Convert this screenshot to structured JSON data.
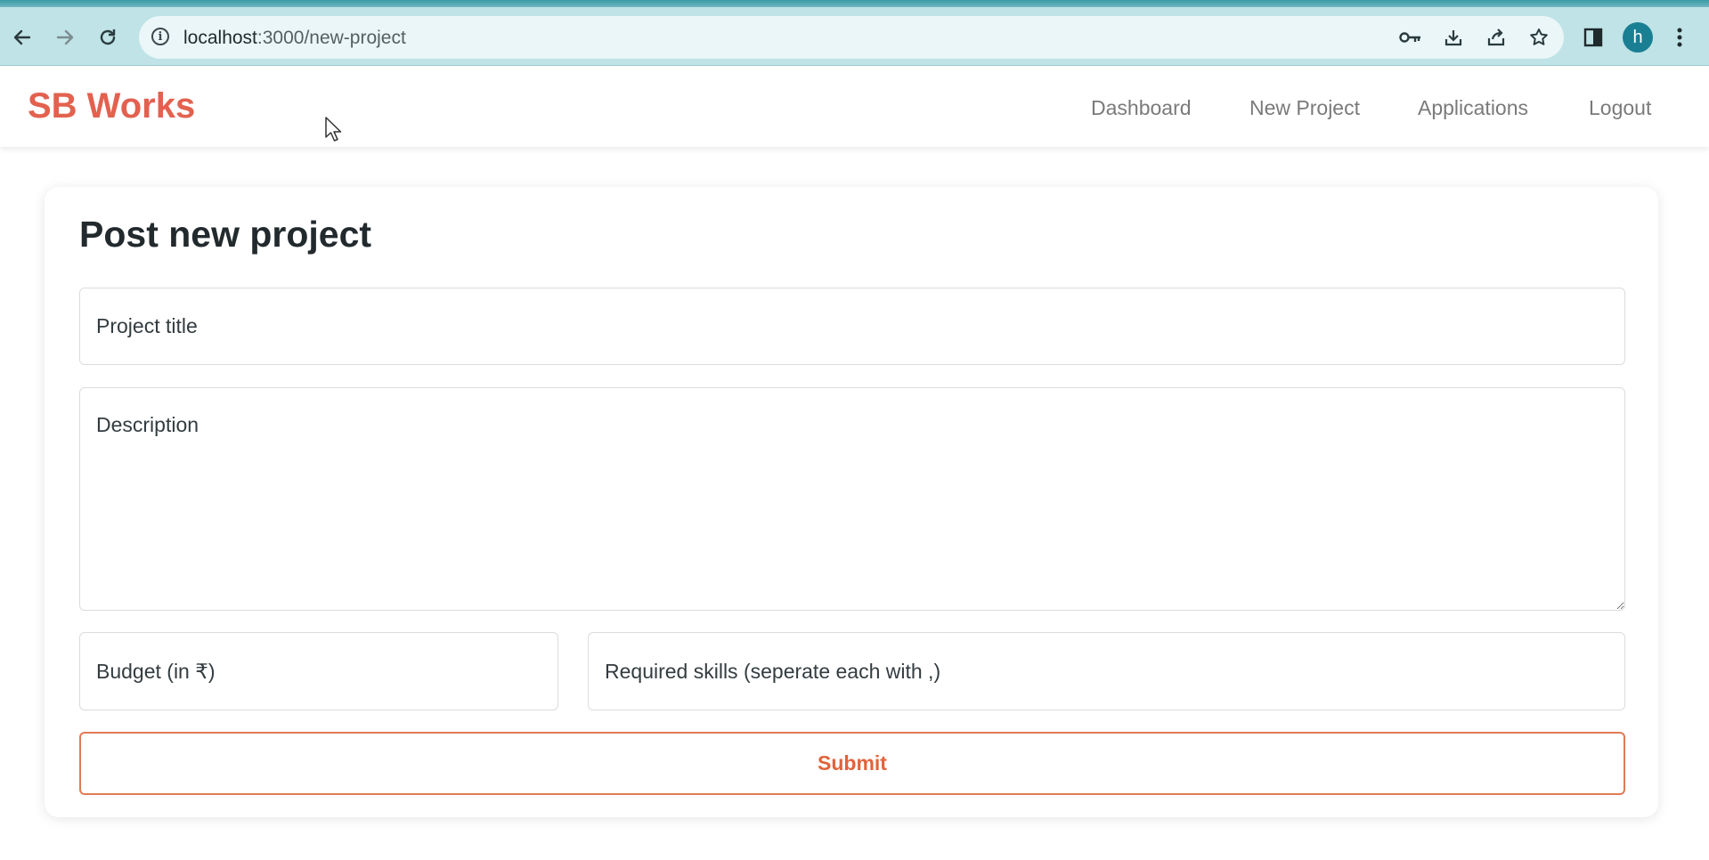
{
  "browser": {
    "url_host": "localhost",
    "url_path": ":3000/new-project",
    "profile_initial": "h",
    "colors": {
      "frame": "#bfe3e7",
      "avatar": "#1a7f93"
    }
  },
  "navbar": {
    "brand": "SB Works",
    "links": [
      "Dashboard",
      "New Project",
      "Applications",
      "Logout"
    ],
    "colors": {
      "brand": "#e3614f",
      "link": "#7a7a7a"
    }
  },
  "form": {
    "title": "Post new project",
    "title_placeholder": "Project title",
    "description_placeholder": "Description",
    "budget_placeholder": "Budget (in ₹)",
    "skills_placeholder": "Required skills (seperate each with ,)",
    "submit_label": "Submit",
    "colors": {
      "submit": "#e2633b"
    }
  }
}
